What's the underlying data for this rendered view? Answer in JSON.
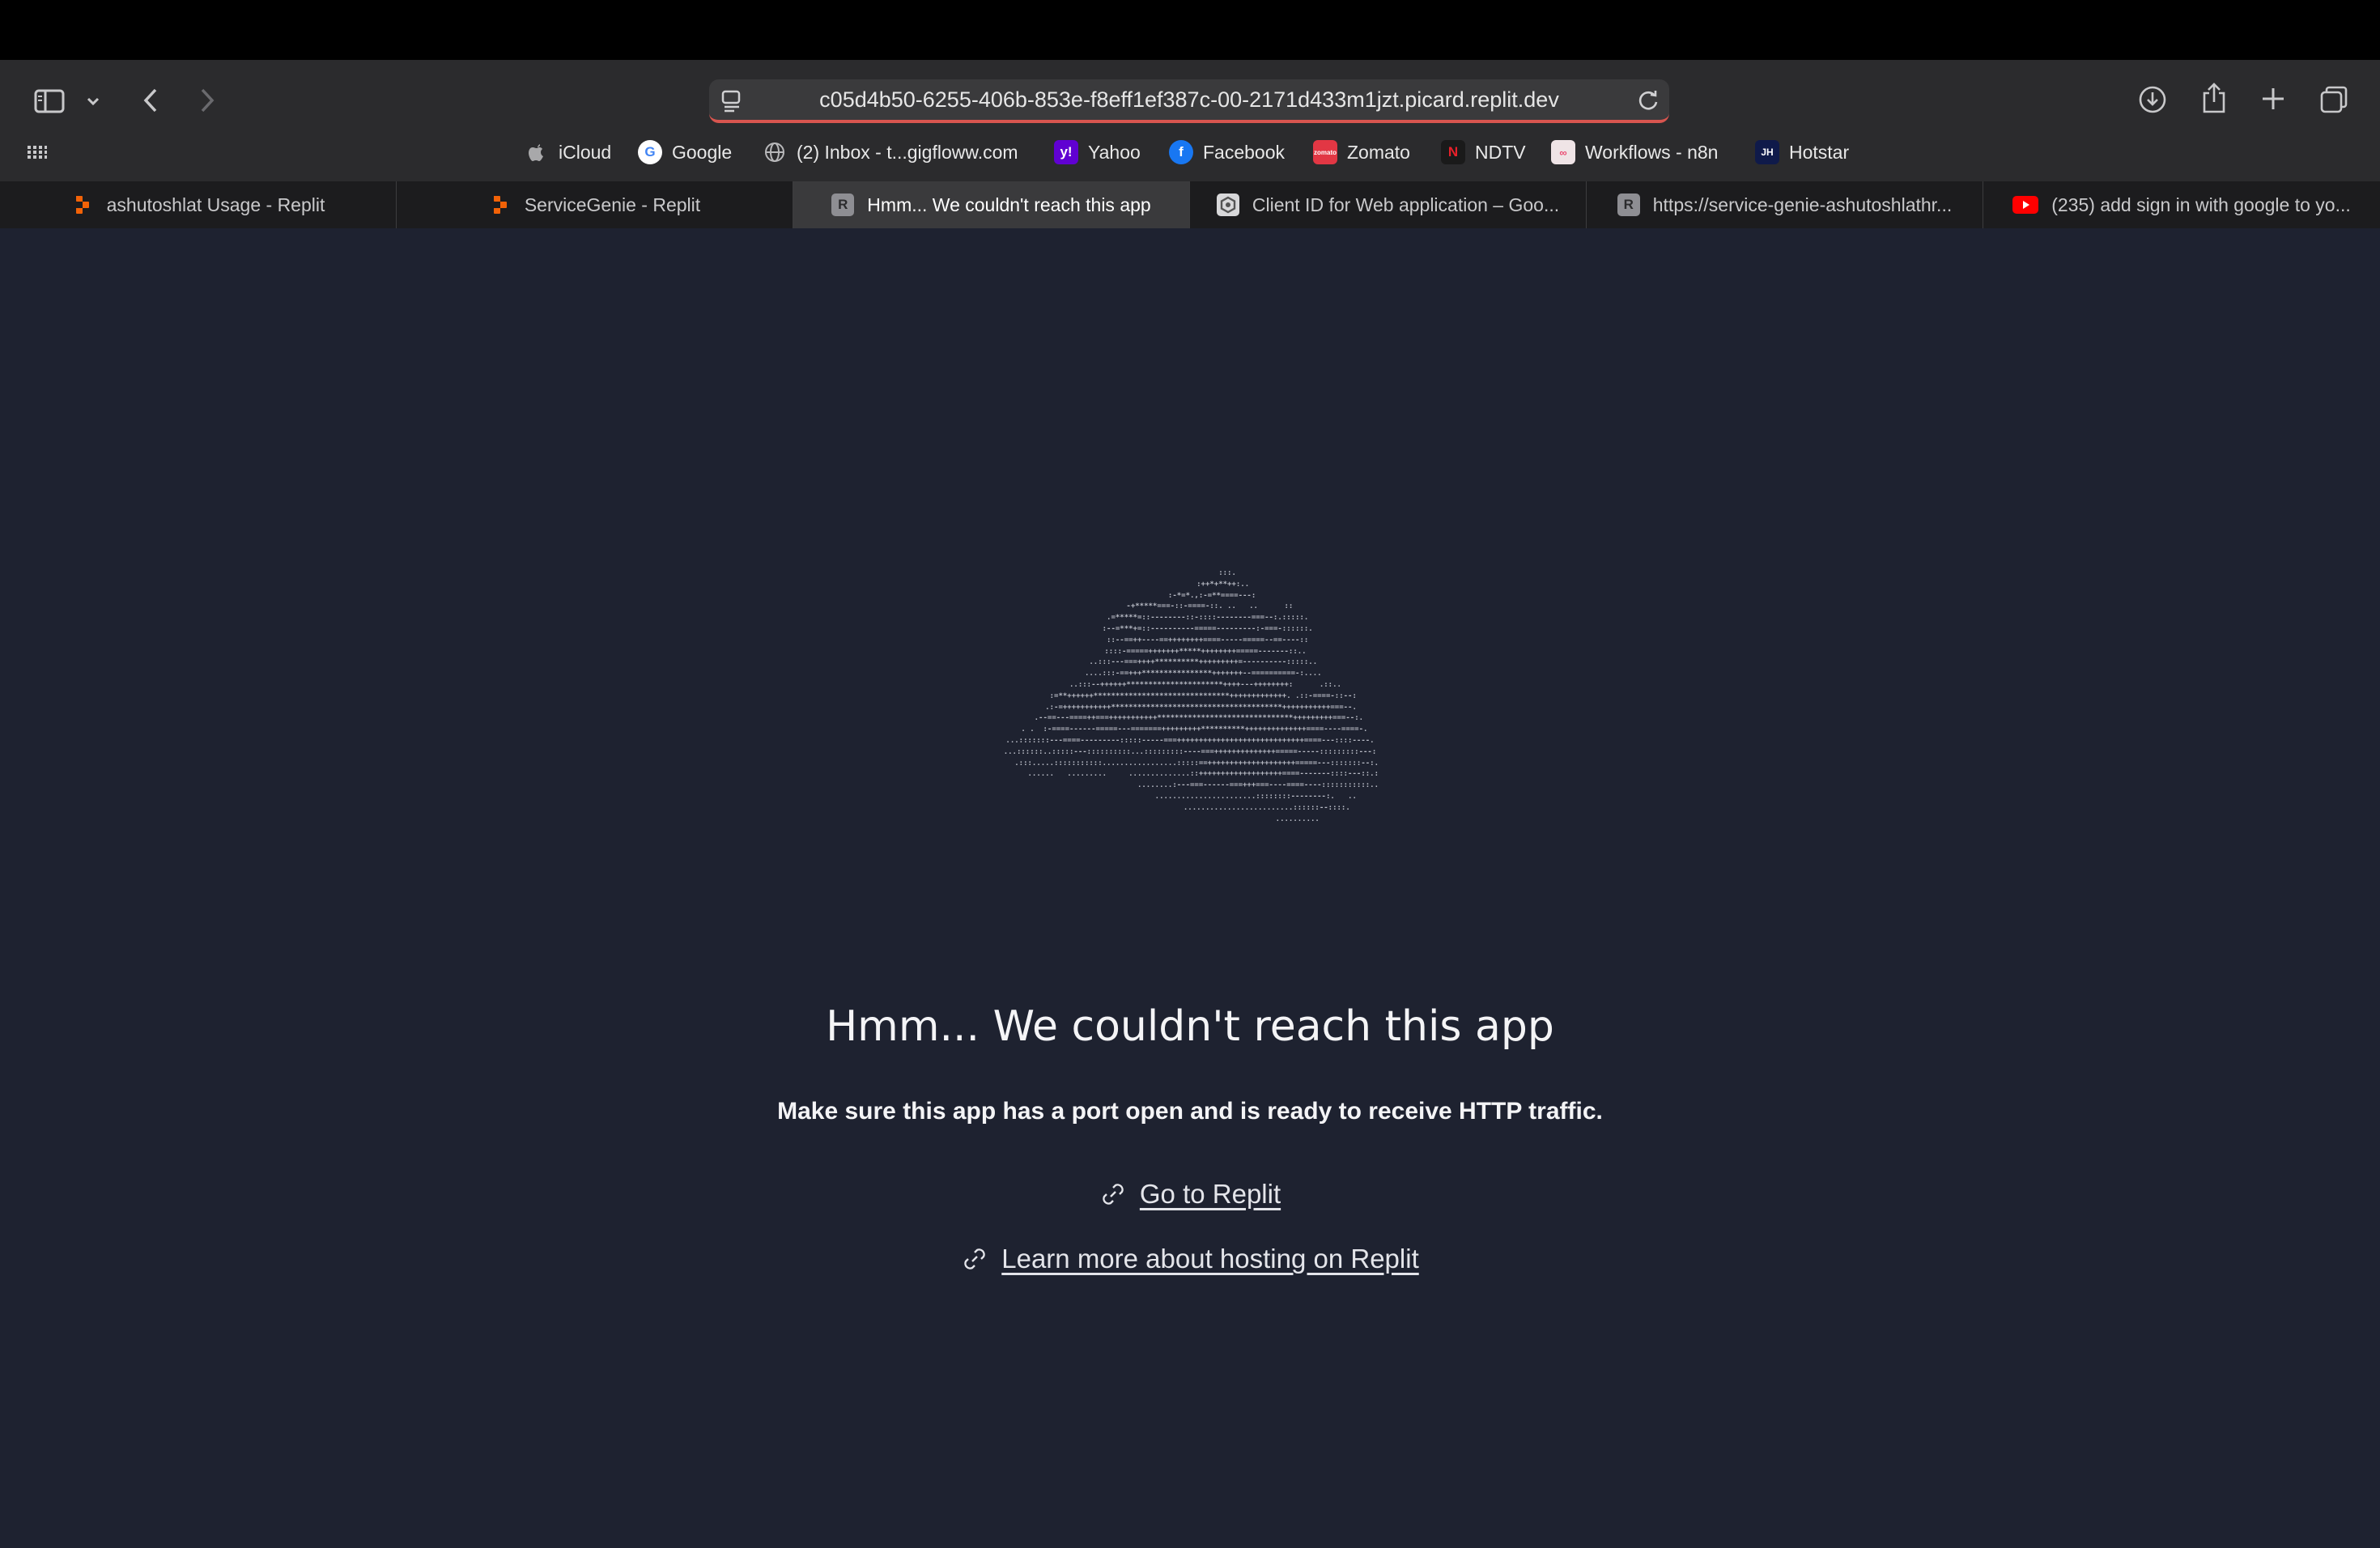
{
  "browser": {
    "url": "c05d4b50-6255-406b-853e-f8eff1ef387c-00-2171d433m1jzt.picard.replit.dev",
    "bookmarks": [
      {
        "label": "iCloud",
        "icon": "apple-icon"
      },
      {
        "label": "Google",
        "icon": "google-icon"
      },
      {
        "label": "(2) Inbox - t...gigfloww.com",
        "icon": "globe-icon"
      },
      {
        "label": "Yahoo",
        "icon": "yahoo-icon"
      },
      {
        "label": "Facebook",
        "icon": "facebook-icon"
      },
      {
        "label": "Zomato",
        "icon": "zomato-icon"
      },
      {
        "label": "NDTV",
        "icon": "ndtv-icon"
      },
      {
        "label": "Workflows - n8n",
        "icon": "n8n-icon"
      },
      {
        "label": "Hotstar",
        "icon": "hotstar-icon"
      }
    ],
    "tabs": [
      {
        "label": "ashutoshlat Usage - Replit",
        "icon": "replit-icon"
      },
      {
        "label": "ServiceGenie - Replit",
        "icon": "replit-icon"
      },
      {
        "label": "Hmm... We couldn't reach this app",
        "icon": "r-icon",
        "active": true
      },
      {
        "label": "Client ID for Web application – Goo...",
        "icon": "google-cloud-icon"
      },
      {
        "label": "https://service-genie-ashutoshlathr...",
        "icon": "r-icon"
      },
      {
        "label": "(235) add sign in with google to yo...",
        "icon": "youtube-icon"
      }
    ]
  },
  "page": {
    "headline": "Hmm... We couldn't reach this app",
    "message": "Make sure this app has a port open and is ready to receive HTTP traffic.",
    "links": [
      {
        "label": "Go to Replit",
        "icon": "link-icon"
      },
      {
        "label": "Learn more about hosting on Replit",
        "icon": "link-icon"
      }
    ]
  },
  "colors": {
    "background": "#1e2230",
    "toolbar": "#2b2b2d",
    "url_loading_bar": "#d8554f"
  }
}
